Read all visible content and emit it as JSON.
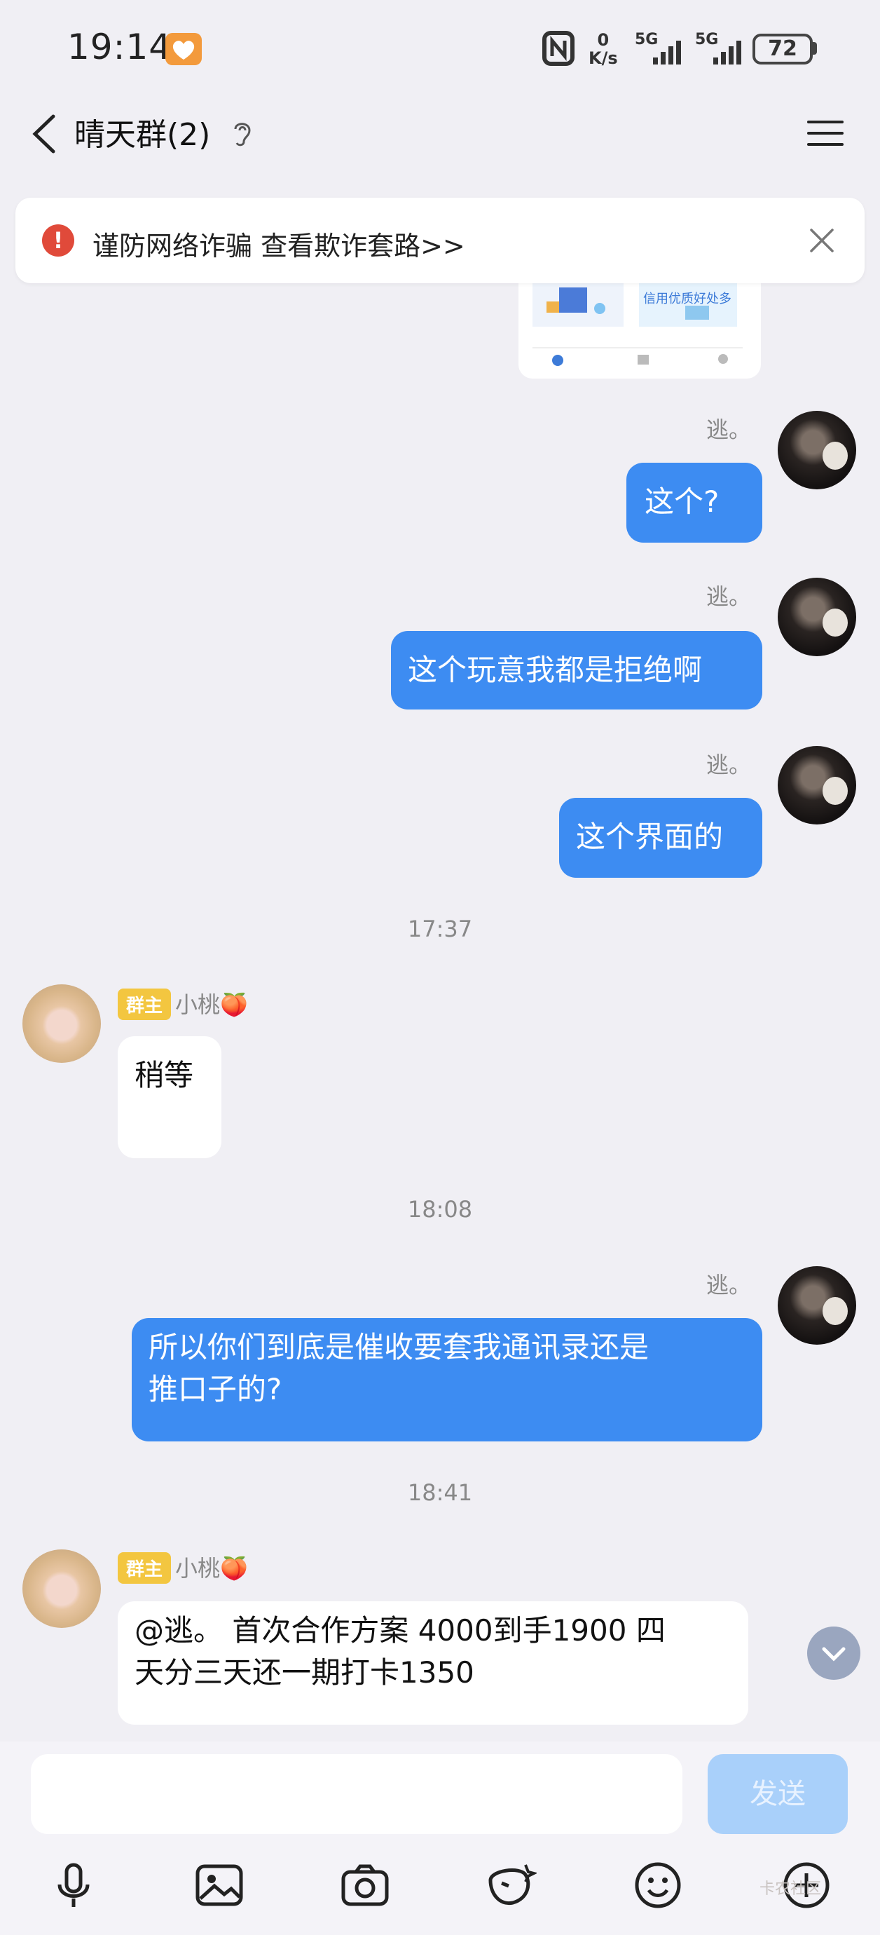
{
  "status_bar": {
    "time": "19:14",
    "speed_value": "0",
    "speed_unit": "K/s",
    "network1": "5G",
    "network2": "5G",
    "battery": "72"
  },
  "header": {
    "title": "晴天群(2)",
    "back_icon": "chevron-left-icon",
    "menu_icon": "hamburger-icon"
  },
  "notice": {
    "text": "谨防网络诈骗 查看欺诈套路>>",
    "close_icon": "close-icon"
  },
  "image_card": {
    "label": "信用优质好处多"
  },
  "messages": {
    "m1": {
      "sender": "逃。",
      "text": "这个?"
    },
    "m2": {
      "sender": "逃。",
      "text": "这个玩意我都是拒绝啊"
    },
    "m3": {
      "sender": "逃。",
      "text": "这个界面的"
    },
    "t1": "17:37",
    "m4": {
      "badge": "群主",
      "sender": "小桃🍑",
      "text": "稍等"
    },
    "t2": "18:08",
    "m5": {
      "sender": "逃。",
      "line1": "所以你们到底是催收要套我通讯录还是",
      "line2": "推口子的?"
    },
    "t3": "18:41",
    "m6": {
      "badge": "群主",
      "sender": "小桃🍑",
      "line1": "@逃。 首次合作方案 4000到手1900 四",
      "line2": "天分三天还一期打卡1350"
    }
  },
  "input": {
    "placeholder": "",
    "send_label": "发送"
  },
  "toolbar": {
    "icons": [
      "microphone-icon",
      "image-icon",
      "camera-icon",
      "sticker-icon",
      "emoji-icon",
      "plus-icon"
    ]
  },
  "watermark": "卡农社区"
}
